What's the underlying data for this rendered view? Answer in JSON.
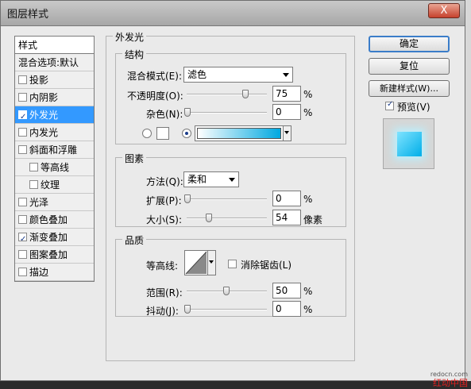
{
  "window": {
    "title": "图层样式",
    "close_label": "X"
  },
  "style_list": {
    "header": "样式",
    "blend_options": "混合选项:默认",
    "items": [
      {
        "label": "投影",
        "checked": false,
        "indent": false,
        "selected": false
      },
      {
        "label": "内阴影",
        "checked": false,
        "indent": false,
        "selected": false
      },
      {
        "label": "外发光",
        "checked": true,
        "indent": false,
        "selected": true
      },
      {
        "label": "内发光",
        "checked": false,
        "indent": false,
        "selected": false
      },
      {
        "label": "斜面和浮雕",
        "checked": false,
        "indent": false,
        "selected": false
      },
      {
        "label": "等高线",
        "checked": false,
        "indent": true,
        "selected": false
      },
      {
        "label": "纹理",
        "checked": false,
        "indent": true,
        "selected": false
      },
      {
        "label": "光泽",
        "checked": false,
        "indent": false,
        "selected": false
      },
      {
        "label": "颜色叠加",
        "checked": false,
        "indent": false,
        "selected": false
      },
      {
        "label": "渐变叠加",
        "checked": true,
        "indent": false,
        "selected": false
      },
      {
        "label": "图案叠加",
        "checked": false,
        "indent": false,
        "selected": false
      },
      {
        "label": "描边",
        "checked": false,
        "indent": false,
        "selected": false
      }
    ]
  },
  "outer_glow": {
    "title": "外发光",
    "structure": {
      "title": "结构",
      "blend_mode_label": "混合模式(E):",
      "blend_mode_value": "滤色",
      "opacity_label": "不透明度(O):",
      "opacity_value": "75",
      "opacity_unit": "%",
      "noise_label": "杂色(N):",
      "noise_value": "0",
      "noise_unit": "%",
      "color_mode": "gradient",
      "gradient_colors": [
        "#ffffff",
        "#00a8e0"
      ]
    },
    "elements": {
      "title": "图素",
      "technique_label": "方法(Q):",
      "technique_value": "柔和",
      "spread_label": "扩展(P):",
      "spread_value": "0",
      "spread_unit": "%",
      "size_label": "大小(S):",
      "size_value": "54",
      "size_unit": "像素"
    },
    "quality": {
      "title": "品质",
      "contour_label": "等高线:",
      "anti_aliased_label": "消除锯齿(L)",
      "anti_aliased_checked": false,
      "range_label": "范围(R):",
      "range_value": "50",
      "range_unit": "%",
      "jitter_label": "抖动(J):",
      "jitter_value": "0",
      "jitter_unit": "%"
    }
  },
  "buttons": {
    "ok": "确定",
    "reset": "复位",
    "new_style": "新建样式(W)...",
    "preview_label": "预览(V)",
    "preview_checked": true
  },
  "watermark": {
    "site": "redocn.com",
    "name": "红动中国"
  }
}
